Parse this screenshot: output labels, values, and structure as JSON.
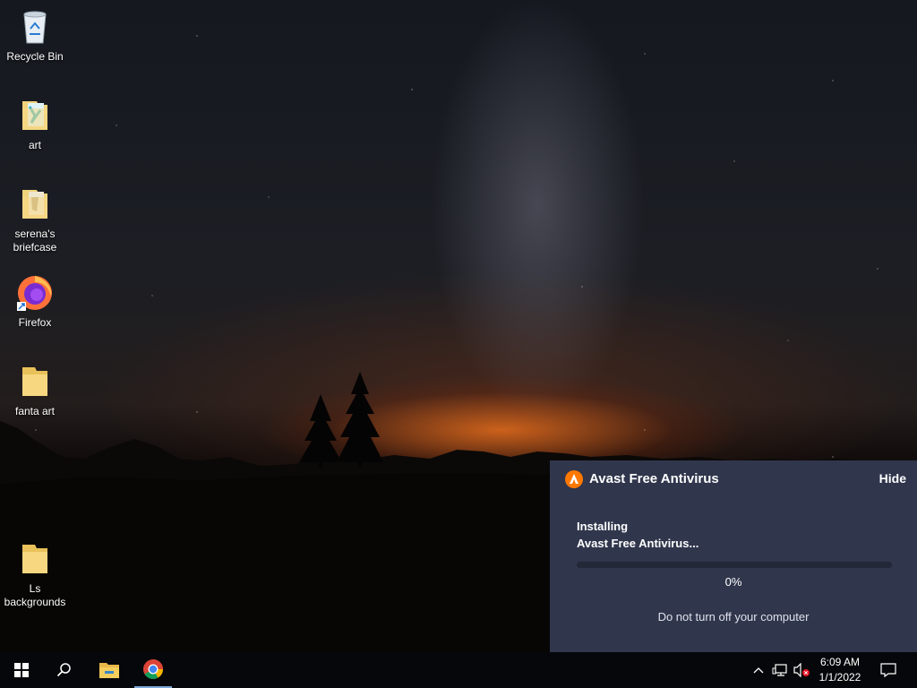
{
  "desktop": {
    "icons": [
      {
        "label": "Recycle Bin"
      },
      {
        "label": "art"
      },
      {
        "label": "serena's briefcase"
      },
      {
        "label": "Firefox"
      },
      {
        "label": "fanta art"
      },
      {
        "label": "Ls backgrounds"
      }
    ]
  },
  "notification": {
    "app_name": "Avast Free Antivirus",
    "hide_label": "Hide",
    "status_line1": "Installing",
    "status_line2": "Avast Free Antivirus...",
    "progress_fraction": 0.0,
    "progress_text": "0%",
    "message": "Do not turn off your computer",
    "accent_color": "#ff7800"
  },
  "taskbar": {
    "start_icon": "windows-start-icon",
    "search_icon": "search-icon",
    "pinned": [
      {
        "icon": "file-explorer-icon"
      },
      {
        "icon": "chrome-icon",
        "active": true
      }
    ],
    "tray": {
      "overflow_icon": "chevron-up-icon",
      "network_icon": "network-icon",
      "volume_icon": "volume-muted-icon",
      "time": "6:09 AM",
      "date": "1/1/2022",
      "notifications_icon": "action-center-icon"
    }
  }
}
